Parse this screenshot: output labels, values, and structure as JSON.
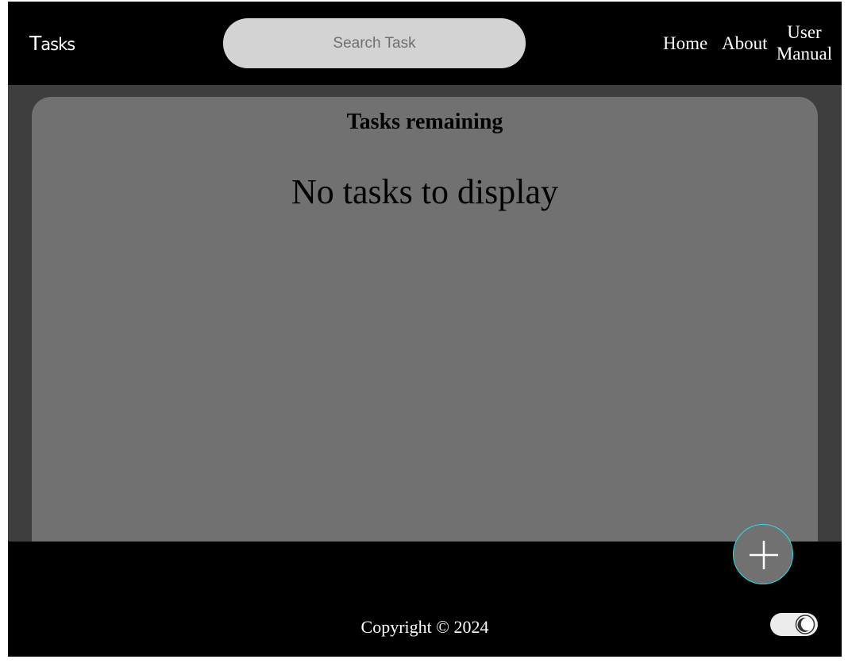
{
  "header": {
    "logo": {
      "first": "T",
      "rest": "asks"
    },
    "search": {
      "placeholder": "Search Task",
      "value": ""
    },
    "nav": {
      "home": "Home",
      "about": "About",
      "manual_line1": "User",
      "manual_line2": "Manual"
    }
  },
  "main": {
    "title": "Tasks remaining",
    "empty_message": "No tasks to display"
  },
  "fab": {
    "icon": "plus-icon",
    "accent_color": "#27e0e6"
  },
  "footer": {
    "copyright": "Copyright © 2024",
    "theme_toggle_icon": "moon-icon"
  },
  "colors": {
    "header_bg": "#000000",
    "main_bg": "#3e3e3e",
    "panel_bg": "#717171",
    "search_bg": "#d3d3d3"
  }
}
